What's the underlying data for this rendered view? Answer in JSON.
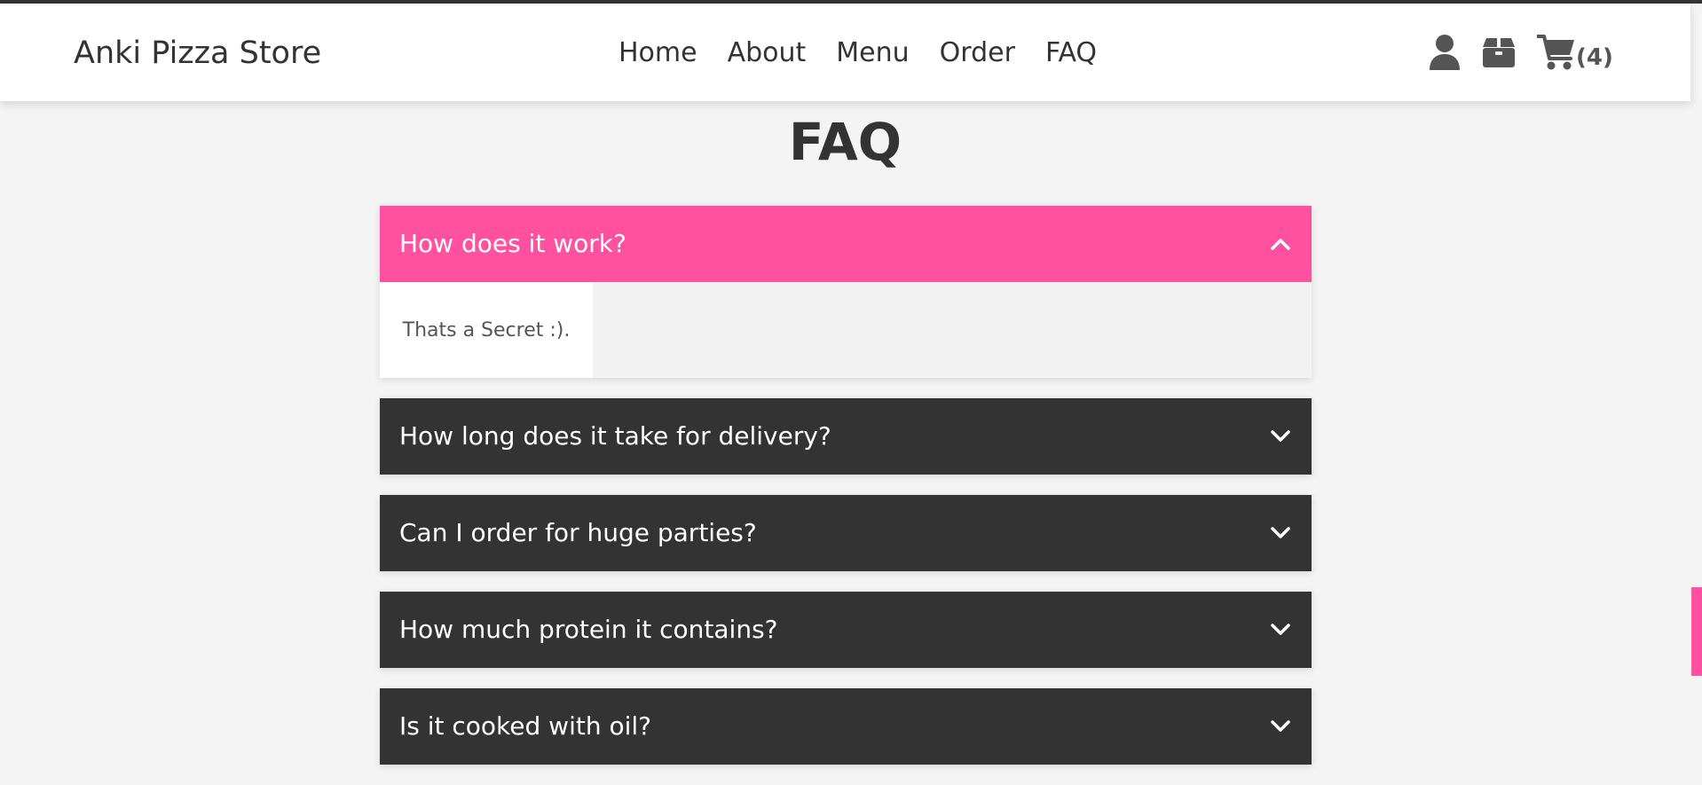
{
  "header": {
    "brand": "Anki Pizza Store",
    "nav": [
      {
        "label": "Home"
      },
      {
        "label": "About"
      },
      {
        "label": "Menu"
      },
      {
        "label": "Order"
      },
      {
        "label": "FAQ"
      }
    ],
    "icons": [
      "user-icon",
      "box-icon",
      "cart-icon"
    ],
    "cart_count": "(4)"
  },
  "page": {
    "title": "FAQ"
  },
  "faq": [
    {
      "question": "How does it work?",
      "answer": "Thats a Secret :).",
      "expanded": true
    },
    {
      "question": "How long does it take for delivery?",
      "expanded": false
    },
    {
      "question": "Can I order for huge parties?",
      "expanded": false
    },
    {
      "question": "How much protein it contains?",
      "expanded": false
    },
    {
      "question": "Is it cooked with oil?",
      "expanded": false
    }
  ],
  "colors": {
    "accent": "#ff519f",
    "dark": "#333333",
    "background": "#f4f4f4",
    "text": "#333333"
  }
}
